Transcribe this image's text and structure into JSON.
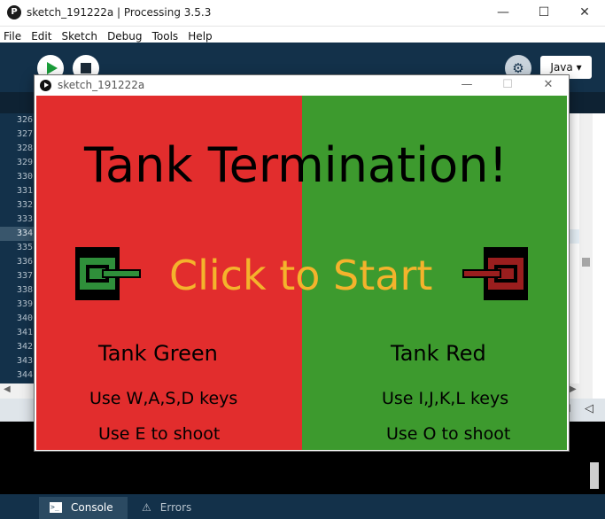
{
  "ide": {
    "logo": "P",
    "title": "sketch_191222a | Processing 3.5.3",
    "window_minimize": "—",
    "window_maximize": "☐",
    "window_close": "✕",
    "menu": [
      "File",
      "Edit",
      "Sketch",
      "Debug",
      "Tools",
      "Help"
    ],
    "mode_label": "Java ▾",
    "debug_icon": "⚙",
    "line_numbers": [
      "326",
      "327",
      "328",
      "329",
      "330",
      "331",
      "332",
      "333",
      "334",
      "335",
      "336",
      "337",
      "338",
      "339",
      "340",
      "341",
      "342",
      "343",
      "344"
    ],
    "highlighted_line": "334",
    "hscroll_left": "◀",
    "hscroll_right": "▶",
    "status_icon1": "⊞",
    "status_icon2": "◁",
    "tabs": {
      "console": "Console",
      "errors": "Errors"
    }
  },
  "sketch": {
    "title": "sketch_191222a",
    "window_minimize": "—",
    "window_maximize": "☐",
    "window_close": "✕",
    "game_title": "Tank Termination!",
    "start_text": "Click to Start",
    "player_green": {
      "name": "Tank Green",
      "keys": "Use W,A,S,D keys",
      "shoot": "Use E to shoot"
    },
    "player_red": {
      "name": "Tank Red",
      "keys": "Use I,J,K,L keys",
      "shoot": "Use O to shoot"
    },
    "colors": {
      "red_half": "#e22d2d",
      "green_half": "#3d9a2e",
      "start_text": "#f4b32c",
      "green_tank": "#2f8f3a",
      "red_tank": "#9a1e1e"
    }
  }
}
